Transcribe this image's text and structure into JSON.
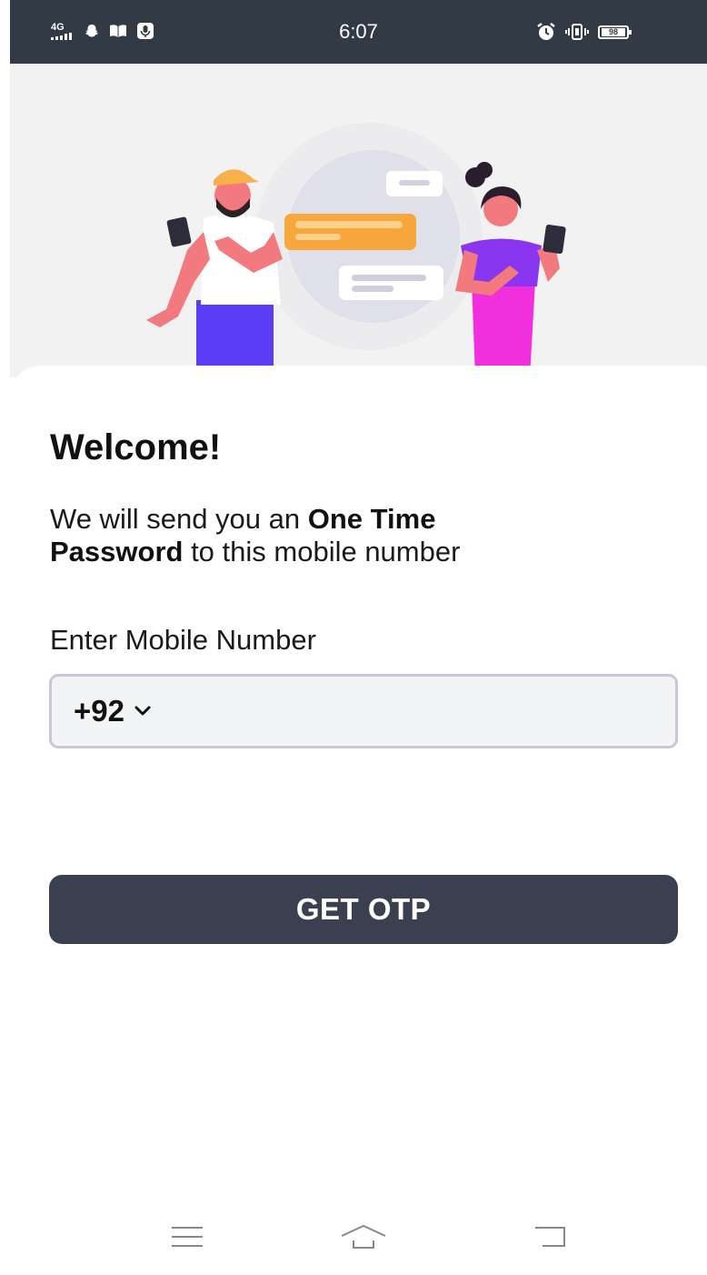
{
  "status_bar": {
    "network": "4G",
    "time": "6:07",
    "battery": "98",
    "icons": [
      "signal-icon",
      "snapchat-icon",
      "book-icon",
      "voice-recorder-icon",
      "alarm-icon",
      "vibrate-icon",
      "battery-icon"
    ]
  },
  "hero": {
    "illustration": "two-people-chatting-illustration"
  },
  "login": {
    "title": "Welcome!",
    "description_prefix": "We will send you an ",
    "description_bold_1": "One Time",
    "description_bold_2": "Password",
    "description_suffix": " to this mobile number",
    "mobile_label": "Enter Mobile Number",
    "country_code": "+92",
    "button_label": "GET OTP"
  },
  "navigation_bar": {
    "items": [
      "menu-icon",
      "home-icon",
      "back-icon"
    ]
  },
  "colors": {
    "status_bar": "#323a46",
    "button": "#3a4050",
    "input_border": "#c9c8d6",
    "hero_background": "#f2f2f3"
  }
}
